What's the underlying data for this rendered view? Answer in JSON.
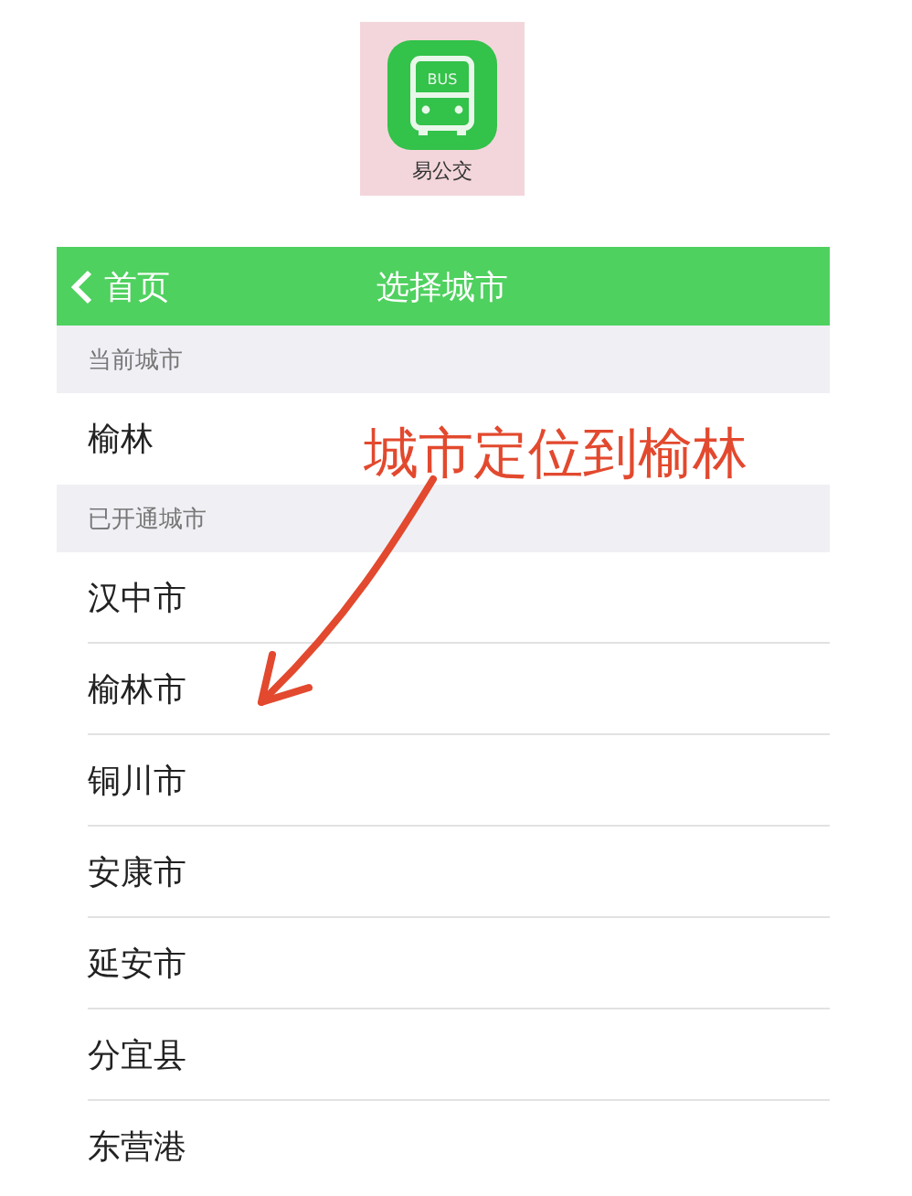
{
  "app_icon": {
    "label": "易公交",
    "badge": "BUS"
  },
  "nav_bar": {
    "back": "首页",
    "title": "选择城市"
  },
  "sections": [
    {
      "header": "当前城市",
      "rows": [
        "榆林"
      ]
    },
    {
      "header": "已开通城市",
      "rows": [
        "汉中市",
        "榆林市",
        "铜川市",
        "安康市",
        "延安市",
        "分宜县",
        "东营港"
      ]
    }
  ],
  "annotation": {
    "text": "城市定位到榆林"
  }
}
